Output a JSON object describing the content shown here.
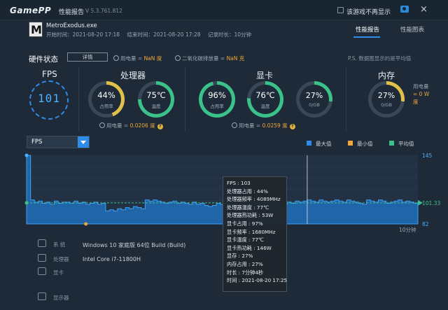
{
  "titlebar": {
    "logo": "GamePP",
    "title": "性能报告",
    "version": "V 5.3.761.812",
    "hide_game_label": "该游戏不再显示",
    "close": "×"
  },
  "session": {
    "game_name": "MetroExodus.exe",
    "start_time": "开始时间：2021-08-20 17:18",
    "end_time": "结束时间：2021-08-20 17:28",
    "duration": "记录时长：10分钟"
  },
  "tabs": [
    {
      "label": "性能报告",
      "active": true
    },
    {
      "label": "性能图表",
      "active": false
    }
  ],
  "hardware": {
    "title": "硬件状态",
    "details_button": "详情",
    "power_label": "用电量 = ",
    "power_value": "NaN 度",
    "co2_label": "二氧化碳排放量 = ",
    "co2_value": "NaN 克",
    "ps_note": "P.S. 数据图显示的是平均值"
  },
  "fps": {
    "title": "FPS",
    "value": "101"
  },
  "cpu": {
    "title": "处理器",
    "gauges": [
      {
        "value": "44%",
        "label": "占用率",
        "color": "#e0c04a",
        "fraction": 0.44
      },
      {
        "value": "75℃",
        "label": "温度",
        "color": "#3ac28a",
        "fraction": 0.75
      }
    ],
    "power_label": "用电量 = ",
    "power_value": "0.0206 度"
  },
  "gpu": {
    "title": "显卡",
    "gauges": [
      {
        "value": "96%",
        "label": "占用率",
        "color": "#3ac28a",
        "fraction": 0.96
      },
      {
        "value": "76℃",
        "label": "温度",
        "color": "#3ac28a",
        "fraction": 0.76
      },
      {
        "value": "27%",
        "label": "0/GB",
        "color": "#3ac28a",
        "fraction": 0.27
      }
    ],
    "power_label": "用电量 = ",
    "power_value": "0.0259 度"
  },
  "memory": {
    "title": "内存",
    "gauge": {
      "value": "27%",
      "label": "0/GB",
      "color": "#e0c04a",
      "fraction": 0.27
    },
    "power_label": "用电量",
    "power_value": "= 0 W",
    "power_unit": "度"
  },
  "chart_controls": {
    "selected_metric": "FPS",
    "legend": [
      {
        "label": "最大值",
        "color": "#2e8bea"
      },
      {
        "label": "最小值",
        "color": "#f0a73a"
      },
      {
        "label": "平均值",
        "color": "#3ac28a"
      }
    ]
  },
  "chart_data": {
    "type": "area",
    "series_name": "FPS",
    "xlabel": "10分钟",
    "ylim": [
      82,
      145
    ],
    "y_ticks": [
      "145",
      "101.33",
      "82"
    ],
    "max": 145,
    "min": 82,
    "avg": 101.33,
    "x": [
      0,
      1,
      2,
      3,
      4,
      5,
      6,
      7,
      8,
      9,
      10,
      11,
      12,
      13,
      14,
      15,
      16,
      17,
      18,
      19,
      20,
      21,
      22,
      23,
      24,
      25,
      26,
      27,
      28,
      29,
      30,
      31,
      32,
      33,
      34,
      35,
      36,
      37,
      38,
      39,
      40,
      41,
      42,
      43,
      44,
      45,
      46,
      47,
      48,
      49,
      50,
      51,
      52,
      53,
      54,
      55,
      56,
      57,
      58,
      59,
      60,
      61,
      62,
      63,
      64,
      65,
      66,
      67,
      68,
      69,
      70,
      71,
      72,
      73,
      74,
      75,
      76,
      77,
      78,
      79,
      80,
      81,
      82,
      83,
      84,
      85,
      86,
      87,
      88,
      89,
      90,
      91,
      92,
      93,
      94,
      95,
      96,
      97,
      98,
      99
    ],
    "values": [
      145,
      104,
      102,
      103,
      101,
      102,
      100,
      103,
      101,
      102,
      102,
      101,
      103,
      101,
      102,
      100,
      101,
      102,
      100,
      101,
      94,
      95,
      94,
      96,
      95,
      97,
      96,
      98,
      97,
      96,
      104,
      103,
      104,
      103,
      102,
      101,
      102,
      103,
      101,
      102,
      101,
      100,
      102,
      100,
      101,
      99,
      98,
      99,
      101,
      100,
      118,
      119,
      118,
      117,
      118,
      119,
      104,
      105,
      103,
      104,
      101,
      102,
      100,
      101,
      99,
      100,
      102,
      101,
      103,
      102,
      103,
      104,
      103,
      102,
      104,
      103,
      102,
      103,
      104,
      103,
      102,
      104,
      103,
      102,
      101,
      100,
      104,
      103,
      102,
      104,
      103,
      101,
      102,
      103,
      104,
      102,
      103,
      102,
      101,
      102
    ],
    "min_marker_x": 15,
    "hover_x": 71
  },
  "tooltip": {
    "lines": [
      "FPS : 103",
      "处理器占用 : 44%",
      "处理器频率 : 4089MHz",
      "处理器温度 : 77℃",
      "处理器热功耗 : 53W",
      "显卡占用 : 97%",
      "显卡频率 : 1680MHz",
      "显卡温度 : 77℃",
      "显卡热功耗 : 146W",
      "显存 : 27%",
      "内存占用 : 27%",
      "时长 : 7分钟4秒",
      "时间 : 2021-08-20 17:25"
    ]
  },
  "system": {
    "os_label": "系  统",
    "os_value": "Windows 10 家庭版 64位   Build (Build)",
    "cpu_label": "处理器",
    "cpu_value": "Intel Core i7-11800H",
    "gpu_label": "显卡",
    "display_label": "显示器"
  }
}
